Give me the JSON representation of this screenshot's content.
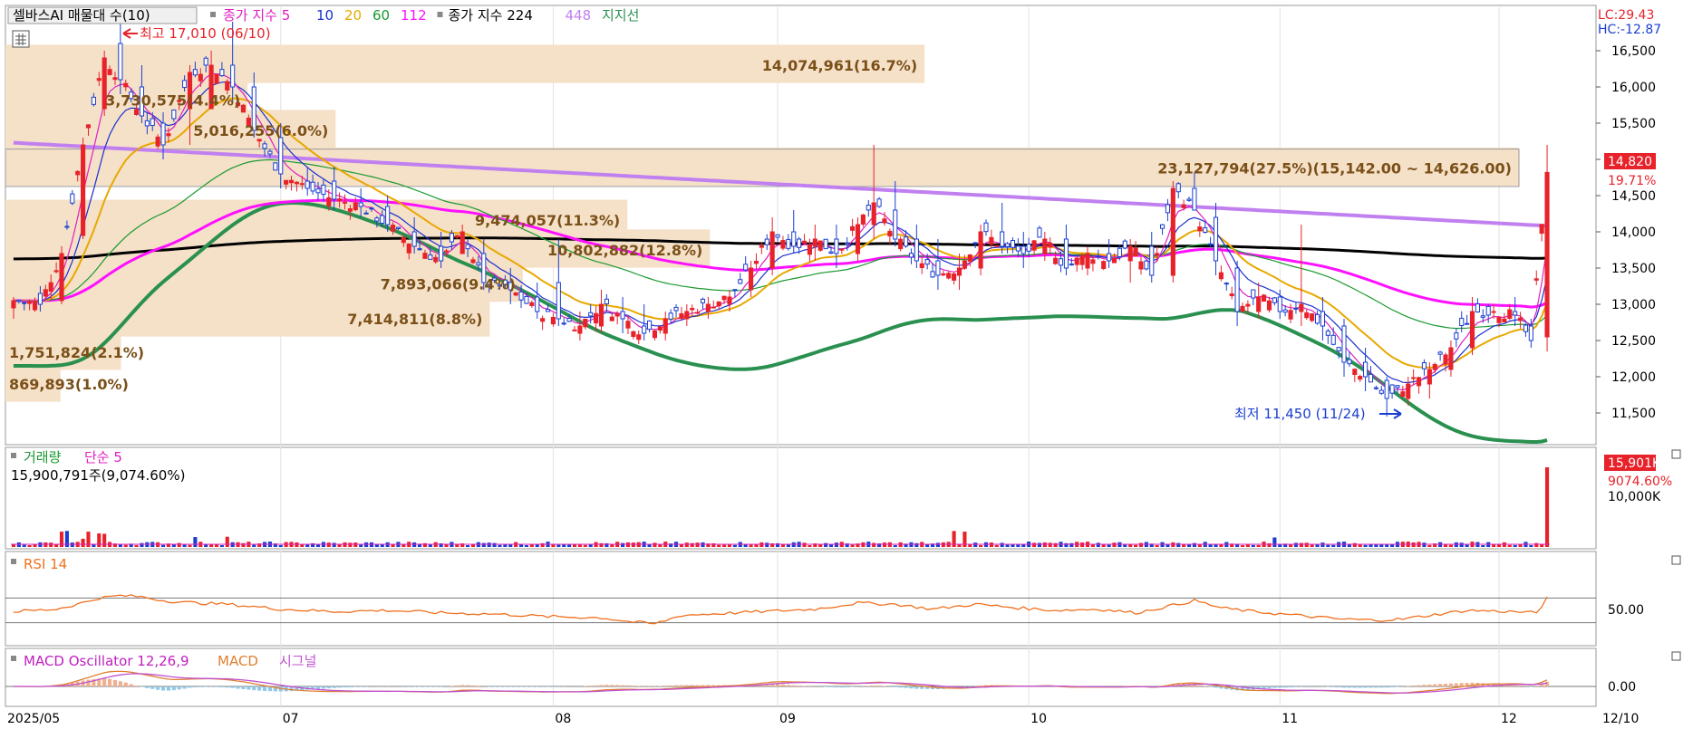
{
  "header": {
    "box_title": "셀바스AI 매물대 수(10)",
    "legend": [
      {
        "text": "종가 지수 5",
        "color": "#e020c0"
      },
      {
        "text": "10",
        "color": "#1a2fcf"
      },
      {
        "text": "20",
        "color": "#e8a800"
      },
      {
        "text": "60",
        "color": "#1a9a30"
      },
      {
        "text": "112",
        "color": "#ff10ff"
      },
      {
        "text": "종가 지수 224",
        "color": "#000000"
      },
      {
        "text": "448",
        "color": "#c080f0"
      },
      {
        "text": "지지선",
        "color": "#2a9050"
      }
    ]
  },
  "corner_labels": {
    "lc": "LC:29.43",
    "hc": "HC:-12.87"
  },
  "price_axis": {
    "ticks": [
      "16,500",
      "16,000",
      "15,500",
      "15,000",
      "14,500",
      "14,000",
      "13,500",
      "13,000",
      "12,500",
      "12,000",
      "11,500"
    ],
    "current_price": "14,820",
    "current_change": "19.71%"
  },
  "date_axis": {
    "ticks": [
      "2025/05",
      "07",
      "08",
      "09",
      "10",
      "11",
      "12"
    ],
    "right_label": "12/10"
  },
  "annotations": {
    "high": "최고 17,010 (06/10)",
    "low": "최저 11,450 (11/24)"
  },
  "volume_profile": [
    {
      "label": "14,074,961(16.7%)",
      "price": 16300,
      "pct": 16.7
    },
    {
      "label": "3,730,575(4.4%)",
      "price": 15820,
      "pct": 4.4
    },
    {
      "label": "5,016,255(6.0%)",
      "price": 15400,
      "pct": 6.0
    },
    {
      "label": "23,127,794(27.5%)(15,142.00 ~ 14,626.00)",
      "price": 14880,
      "pct": 27.5
    },
    {
      "label": "9,474,057(11.3%)",
      "price": 14160,
      "pct": 11.3
    },
    {
      "label": "10,802,882(12.8%)",
      "price": 13750,
      "pct": 12.8
    },
    {
      "label": "7,893,066(9.4%)",
      "price": 13280,
      "pct": 9.4
    },
    {
      "label": "7,414,811(8.8%)",
      "price": 12800,
      "pct": 8.8
    },
    {
      "label": "1,751,824(2.1%)",
      "price": 12340,
      "pct": 2.1
    },
    {
      "label": "869,893(1.0%)",
      "price": 11900,
      "pct": 1.0
    }
  ],
  "volume_panel": {
    "title": "거래량",
    "ma_label": "단순 5",
    "summary": "15,900,791주(9,074.60%)",
    "ticks": [
      "10,000K"
    ],
    "current_value": "15,901K",
    "current_pct": "9074.60%"
  },
  "rsi_panel": {
    "title": "RSI 14",
    "ticks": [
      "50.00"
    ]
  },
  "macd_panel": {
    "title": "MACD Oscillator 12,26,9",
    "macd_label": "MACD",
    "signal_label": "시그널",
    "ticks": [
      "0.00"
    ]
  },
  "colors": {
    "up": "#e8222a",
    "down": "#1a3fd0",
    "ma5": "#e020c0",
    "ma10": "#1a2fcf",
    "ma20": "#e8a800",
    "ma60": "#1a9a30",
    "ma112": "#ff10ff",
    "ma224": "#000000",
    "ma448": "#c080f0",
    "support": "#2a9050",
    "profile": "#f5e0c8",
    "rsi": "#f07020",
    "macd_line": "#e08030",
    "signal_line": "#c050d0"
  },
  "chart_data": {
    "type": "candlestick",
    "price_range": [
      11100,
      17100
    ],
    "ohlc_keypoints": [
      [
        0,
        12950,
        13100,
        12800,
        13050
      ],
      [
        5,
        13150,
        13250,
        12900,
        13000
      ],
      [
        9,
        13050,
        13800,
        13000,
        13700
      ],
      [
        13,
        13950,
        15300,
        13900,
        15200
      ],
      [
        17,
        15700,
        16500,
        15600,
        16400
      ],
      [
        20,
        16600,
        17010,
        15900,
        16100
      ],
      [
        24,
        16000,
        16300,
        15500,
        15600
      ],
      [
        28,
        15500,
        15650,
        15000,
        15200
      ],
      [
        33,
        15700,
        16300,
        15200,
        16200
      ],
      [
        37,
        15700,
        16500,
        15700,
        16300
      ],
      [
        41,
        16300,
        16900,
        15800,
        16000
      ],
      [
        45,
        16000,
        16200,
        15300,
        15400
      ],
      [
        50,
        15300,
        15500,
        14600,
        14800
      ],
      [
        55,
        14700,
        14900,
        14500,
        14600
      ],
      [
        60,
        14700,
        14900,
        14300,
        14450
      ],
      [
        65,
        14400,
        14600,
        14200,
        14350
      ],
      [
        70,
        14350,
        14500,
        14000,
        14100
      ],
      [
        75,
        14000,
        14200,
        13700,
        13800
      ],
      [
        80,
        13800,
        14000,
        13500,
        13600
      ],
      [
        84,
        13700,
        14100,
        13700,
        14000
      ],
      [
        88,
        13700,
        13900,
        13200,
        13300
      ],
      [
        93,
        13300,
        13500,
        13000,
        13200
      ],
      [
        98,
        13100,
        13300,
        12800,
        12900
      ],
      [
        102,
        13300,
        13900,
        12700,
        12800
      ],
      [
        106,
        12600,
        12900,
        12500,
        12700
      ],
      [
        110,
        12700,
        13200,
        12600,
        13000
      ],
      [
        114,
        12900,
        13100,
        12600,
        12800
      ],
      [
        118,
        12700,
        13000,
        12500,
        12600
      ],
      [
        122,
        12600,
        12900,
        12500,
        12800
      ],
      [
        126,
        12800,
        13000,
        12700,
        12900
      ],
      [
        130,
        12900,
        13100,
        12800,
        13000
      ],
      [
        134,
        13000,
        13200,
        12900,
        13100
      ],
      [
        138,
        13200,
        13600,
        13100,
        13500
      ],
      [
        142,
        13500,
        14200,
        13400,
        14000
      ],
      [
        146,
        14000,
        14300,
        13700,
        13800
      ],
      [
        150,
        13800,
        14100,
        13600,
        13900
      ],
      [
        154,
        13900,
        14100,
        13500,
        13700
      ],
      [
        158,
        13700,
        14200,
        13600,
        14100
      ],
      [
        161,
        14100,
        15200,
        13900,
        14400
      ],
      [
        165,
        14300,
        14700,
        13800,
        13900
      ],
      [
        169,
        13900,
        14100,
        13500,
        13600
      ],
      [
        173,
        13600,
        13900,
        13200,
        13400
      ],
      [
        177,
        13400,
        13700,
        13200,
        13500
      ],
      [
        181,
        13500,
        14100,
        13400,
        14000
      ],
      [
        185,
        14000,
        14400,
        13700,
        13800
      ],
      [
        189,
        13800,
        14000,
        13500,
        13700
      ],
      [
        193,
        13700,
        14000,
        13600,
        13900
      ],
      [
        197,
        13900,
        14100,
        13400,
        13500
      ],
      [
        201,
        13500,
        13800,
        13400,
        13700
      ],
      [
        205,
        13700,
        13900,
        13500,
        13600
      ],
      [
        209,
        13600,
        13900,
        13300,
        13800
      ],
      [
        213,
        13800,
        14000,
        13300,
        13400
      ],
      [
        217,
        13400,
        14700,
        13300,
        14600
      ],
      [
        221,
        14600,
        14820,
        14300,
        14300
      ],
      [
        225,
        14200,
        14400,
        13400,
        13600
      ],
      [
        229,
        13500,
        13600,
        12700,
        12900
      ],
      [
        233,
        12900,
        13300,
        12800,
        13100
      ],
      [
        237,
        13100,
        13200,
        12800,
        12900
      ],
      [
        241,
        12900,
        14100,
        12700,
        13000
      ],
      [
        245,
        12900,
        13100,
        12500,
        12700
      ],
      [
        249,
        12700,
        12800,
        12000,
        12200
      ],
      [
        253,
        12200,
        12400,
        11800,
        12000
      ],
      [
        257,
        11950,
        12000,
        11450,
        11700
      ],
      [
        261,
        11700,
        12000,
        11600,
        11900
      ],
      [
        265,
        11900,
        12200,
        11700,
        12100
      ],
      [
        269,
        12100,
        12500,
        12000,
        12400
      ],
      [
        273,
        12400,
        13100,
        12300,
        12900
      ],
      [
        277,
        12900,
        13000,
        12800,
        12900
      ],
      [
        281,
        12900,
        13100,
        12700,
        12850
      ],
      [
        284,
        12700,
        12800,
        12400,
        12500
      ],
      [
        287,
        12550,
        15200,
        12350,
        14820
      ]
    ],
    "n": 288,
    "rsi_range": [
      0,
      100
    ],
    "rsi_keypoints": [
      [
        0,
        48
      ],
      [
        8,
        52
      ],
      [
        12,
        60
      ],
      [
        16,
        70
      ],
      [
        20,
        74
      ],
      [
        24,
        72
      ],
      [
        28,
        66
      ],
      [
        32,
        63
      ],
      [
        40,
        60
      ],
      [
        50,
        52
      ],
      [
        60,
        48
      ],
      [
        70,
        50
      ],
      [
        80,
        46
      ],
      [
        90,
        44
      ],
      [
        100,
        40
      ],
      [
        110,
        38
      ],
      [
        115,
        32
      ],
      [
        120,
        28
      ],
      [
        125,
        42
      ],
      [
        130,
        44
      ],
      [
        140,
        48
      ],
      [
        150,
        52
      ],
      [
        158,
        62
      ],
      [
        165,
        60
      ],
      [
        172,
        52
      ],
      [
        180,
        60
      ],
      [
        188,
        54
      ],
      [
        195,
        50
      ],
      [
        203,
        52
      ],
      [
        210,
        46
      ],
      [
        218,
        60
      ],
      [
        221,
        66
      ],
      [
        226,
        54
      ],
      [
        232,
        48
      ],
      [
        240,
        42
      ],
      [
        248,
        36
      ],
      [
        255,
        34
      ],
      [
        260,
        36
      ],
      [
        265,
        42
      ],
      [
        272,
        50
      ],
      [
        280,
        48
      ],
      [
        285,
        46
      ],
      [
        287,
        70
      ]
    ],
    "macd_range": [
      -1,
      1
    ]
  }
}
